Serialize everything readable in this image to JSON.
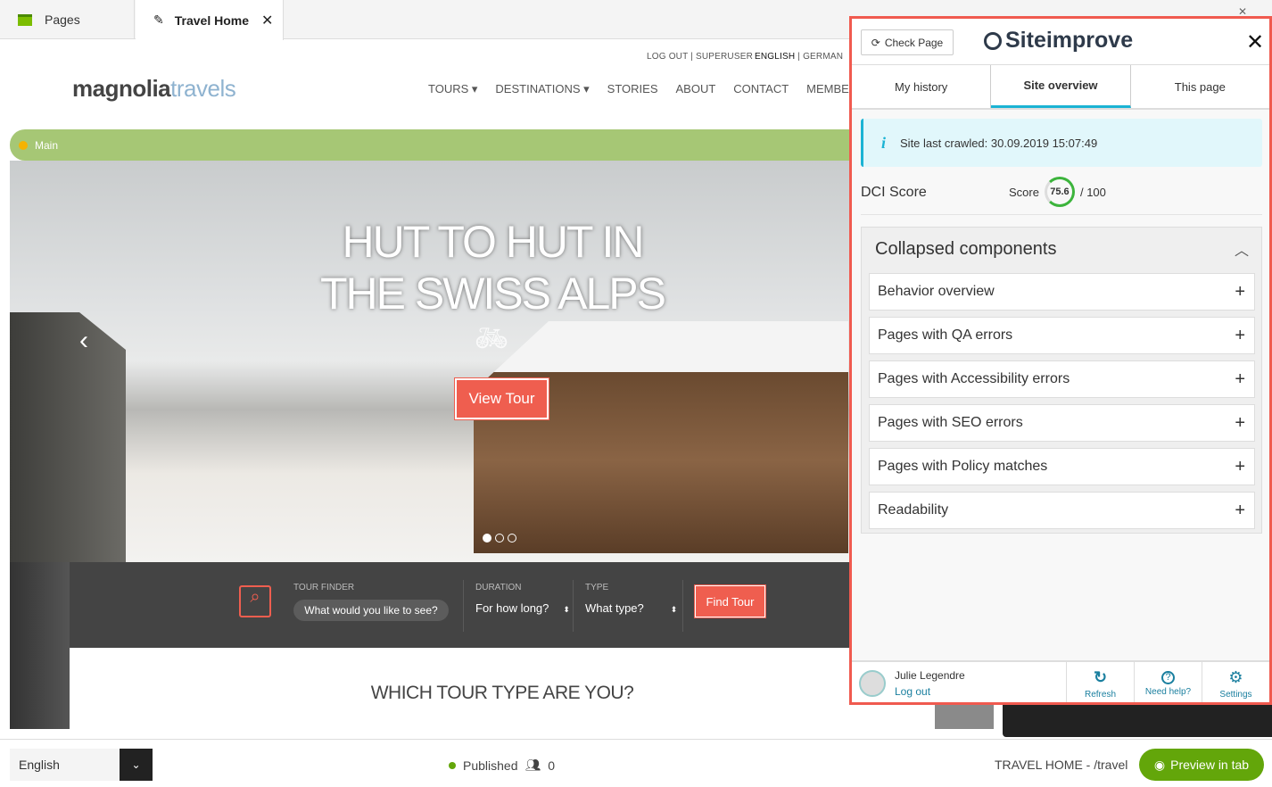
{
  "tabs": {
    "pages": "Pages",
    "current": "Travel Home"
  },
  "site": {
    "top_links": {
      "logout": "LOG OUT | SUPERUSER",
      "lang_active": "ENGLISH",
      "lang_other": "| GERMAN"
    },
    "logo": {
      "part1": "magnolia",
      "part2": "travels"
    },
    "nav": [
      "TOURS",
      "DESTINATIONS",
      "STORIES",
      "ABOUT",
      "CONTACT",
      "MEMBERS"
    ],
    "area_label": "Main",
    "hero": {
      "title": "HUT TO HUT IN THE SWISS ALPS",
      "cta": "View Tour",
      "slides": 3,
      "active_slide": 1
    },
    "finder": {
      "label": "TOUR FINDER",
      "placeholder": "What would you like to see?",
      "duration_label": "DURATION",
      "duration_value": "For how long?",
      "type_label": "TYPE",
      "type_value": "What type?",
      "button": "Find Tour"
    },
    "section_title": "WHICH TOUR TYPE ARE YOU?"
  },
  "footer": {
    "language": "English",
    "status": "Published",
    "users": "0",
    "path": "TRAVEL HOME - /travel",
    "preview": "Preview in tab",
    "status_color": "#63a60a"
  },
  "panel": {
    "check_page": "Check Page",
    "brand": "Siteimprove",
    "tabs": [
      "My history",
      "Site overview",
      "This page"
    ],
    "active_tab": "Site overview",
    "info": "Site last crawled: 30.09.2019 15:07:49",
    "dci_label": "DCI Score",
    "score_label": "Score",
    "score": "75.6",
    "score_max": "/ 100",
    "collapsed_title": "Collapsed components",
    "items": [
      "Behavior overview",
      "Pages with QA errors",
      "Pages with Accessibility errors",
      "Pages with SEO errors",
      "Pages with Policy matches",
      "Readability"
    ],
    "user": "Julie Legendre",
    "logout": "Log out",
    "actions": [
      "Refresh",
      "Need help?",
      "Settings"
    ],
    "accent": "#1bb3d4",
    "highlight_border": "#f05a4f"
  }
}
